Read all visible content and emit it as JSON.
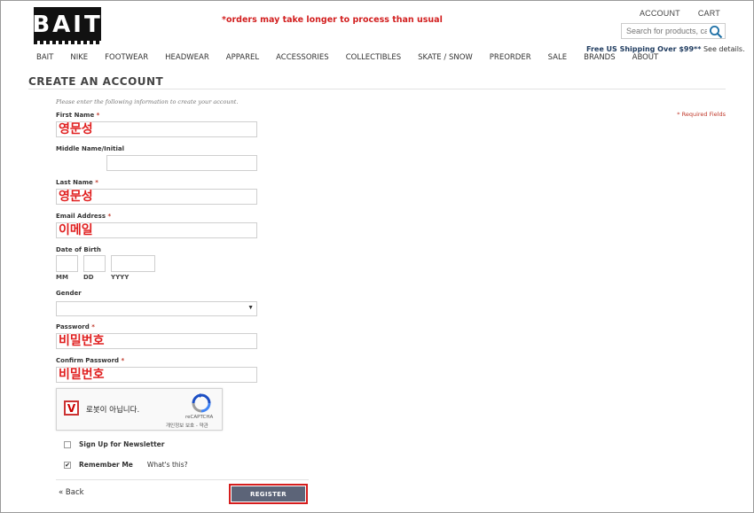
{
  "header": {
    "logo": "BAIT",
    "notice": "*orders may take longer to process than usual",
    "account_link": "ACCOUNT",
    "cart_link": "CART",
    "search_placeholder": "Search for products, ca",
    "shipping_strong": "Free US Shipping Over $99**",
    "shipping_link": "See details."
  },
  "nav": [
    "BAIT",
    "NIKE",
    "FOOTWEAR",
    "HEADWEAR",
    "APPAREL",
    "ACCESSORIES",
    "COLLECTIBLES",
    "SKATE / SNOW",
    "PREORDER",
    "SALE",
    "BRANDS",
    "ABOUT"
  ],
  "page": {
    "title": "CREATE AN ACCOUNT",
    "intro": "Please enter the following information to create your account.",
    "required_note": "* Required Fields"
  },
  "form": {
    "first_name_label": "First Name",
    "first_name_value": "영문성",
    "middle_label": "Middle Name/Initial",
    "last_name_label": "Last Name",
    "last_name_value": "영문성",
    "email_label": "Email Address",
    "email_value": "이메일",
    "dob_label": "Date of Birth",
    "dob_mm": "MM",
    "dob_dd": "DD",
    "dob_yyyy": "YYYY",
    "gender_label": "Gender",
    "password_label": "Password",
    "password_value": "비밀번호",
    "confirm_label": "Confirm Password",
    "confirm_value": "비밀번호",
    "required_mark": "*"
  },
  "captcha": {
    "check_mark": "V",
    "text": "로봇이 아닙니다.",
    "brand": "reCAPTCHA",
    "terms": "개인정보 보호 - 약관"
  },
  "options": {
    "newsletter_label": "Sign Up for Newsletter",
    "remember_label": "Remember Me",
    "remember_checked_mark": "✔",
    "whats_this": "What's this?"
  },
  "actions": {
    "back": "« Back",
    "register": "REGISTER"
  },
  "colors": {
    "accent_red": "#d21f1f",
    "button_bg": "#5c6478",
    "annotation_red": "#e01f1f"
  }
}
